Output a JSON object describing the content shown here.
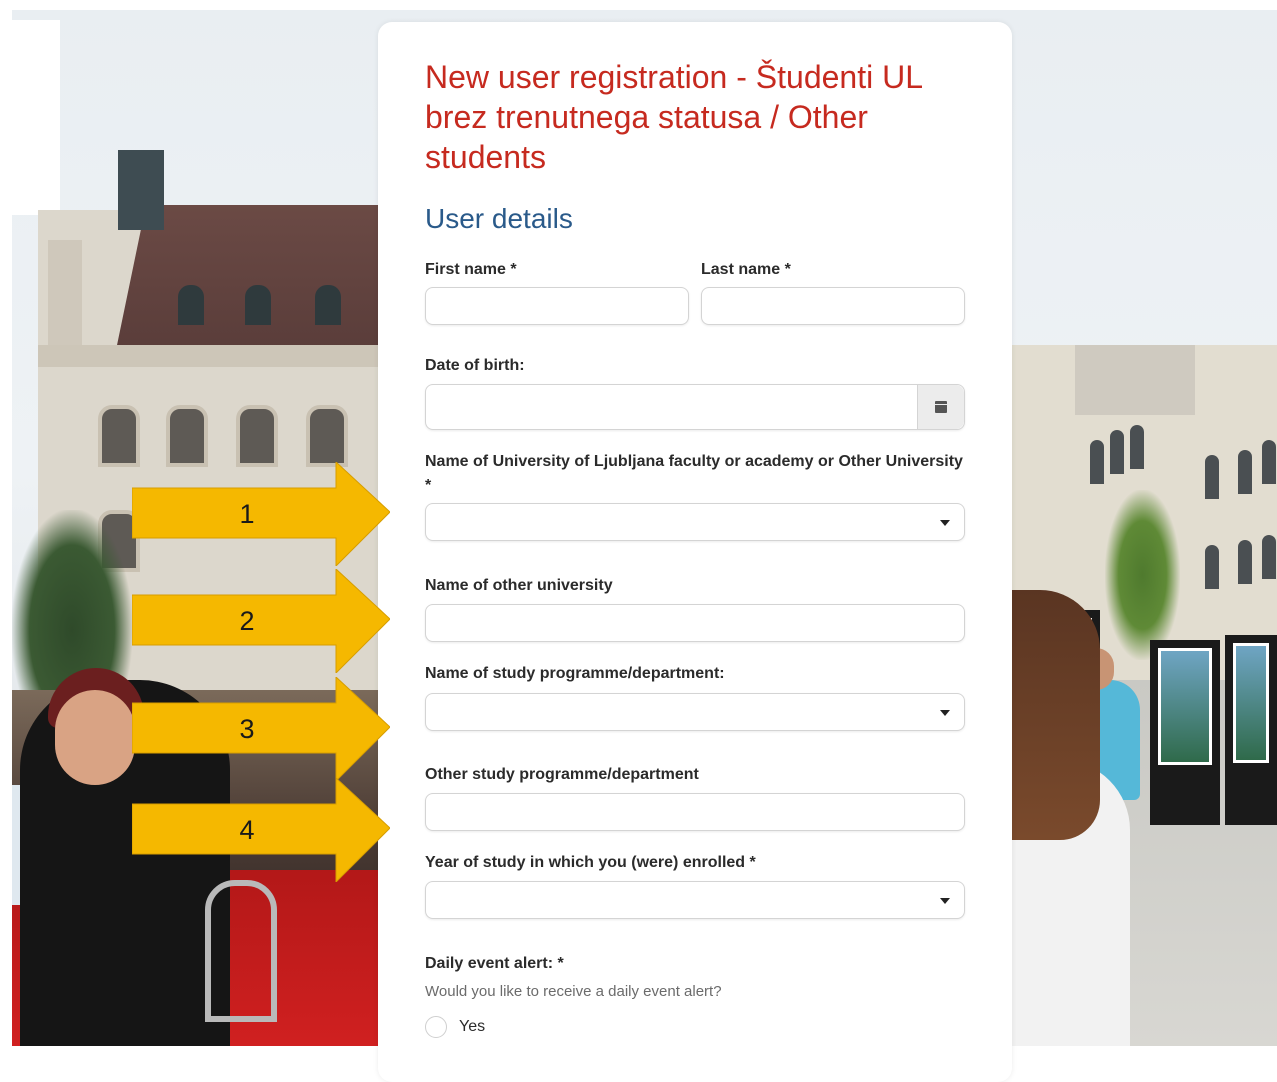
{
  "form": {
    "title": "New user registration - Študenti UL brez trenutnega statusa / Other students",
    "section_title": "User details",
    "first_name_label": "First name *",
    "last_name_label": "Last name *",
    "dob_label": "Date of birth:",
    "faculty_label": "Name of University of Ljubljana faculty or academy or Other University  *",
    "other_university_label": "Name of other university",
    "study_programme_label": "Name of study programme/department:",
    "other_programme_label": "Other study programme/department",
    "year_label": "Year of study in which you (were) enrolled *",
    "alert_label": "Daily event alert: *",
    "alert_hint": "Would you like to receive a daily event alert?",
    "alert_option_yes": "Yes",
    "values": {
      "first_name": "",
      "last_name": "",
      "dob": "",
      "faculty": "",
      "other_university": "",
      "study_programme": "",
      "other_programme": "",
      "year": ""
    }
  },
  "annotations": {
    "arrow1": "1",
    "arrow2": "2",
    "arrow3": "3",
    "arrow4": "4",
    "arrow_color": "#f5b800"
  },
  "icons": {
    "calendar": "calendar-icon",
    "dropdown": "chevron-down-icon"
  },
  "colors": {
    "title": "#c62a1f",
    "section": "#2a5a8a"
  }
}
